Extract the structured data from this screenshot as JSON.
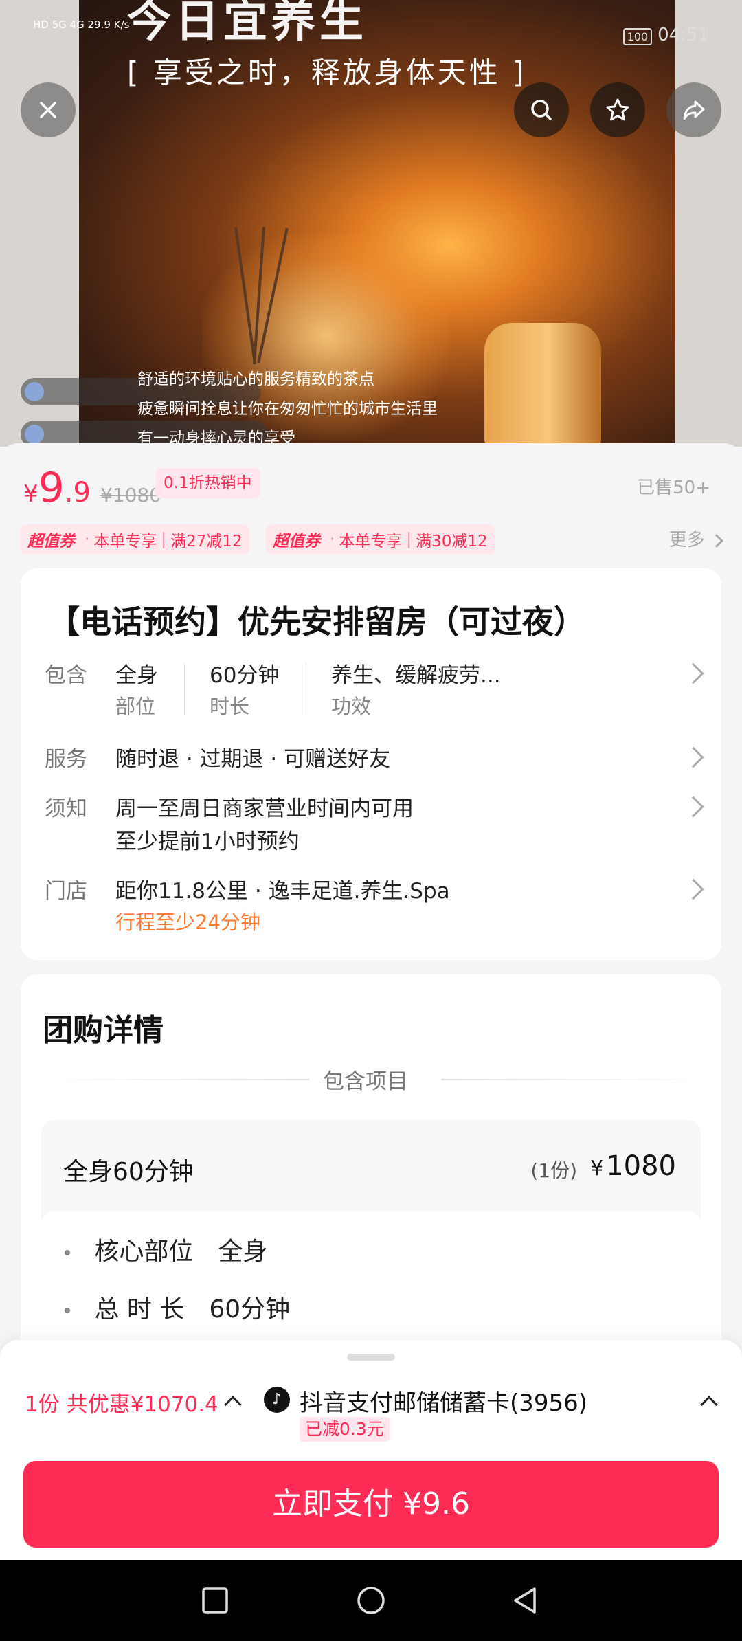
{
  "status_bar": {
    "left": "HD 5G 4G 29.9 K/s",
    "battery": "100",
    "time": "04:51"
  },
  "hero": {
    "title": "今日宜养生",
    "subtitle": "[ 享受之时，释放身体天性 ]",
    "caption_1": "舒适的环境贴心的服务精致的茶点",
    "caption_2": "疲惫瞬间拴息让你在匆匆忙忙的城市生活里",
    "caption_3": "有一动身摔心灵的享受",
    "icons": [
      "close-icon",
      "search-icon",
      "star-icon",
      "share-icon"
    ]
  },
  "price": {
    "symbol": "¥",
    "integer": "9",
    "decimal": ".9",
    "original": "¥1080",
    "tag": "0.1折热销中",
    "sold": "已售50+"
  },
  "coupons": [
    {
      "badge": "超值券",
      "scope": "本单专享",
      "rule": "满27减12"
    },
    {
      "badge": "超值券",
      "scope": "本单专享",
      "rule": "满30减12"
    }
  ],
  "coupons_more": "更多",
  "product": {
    "title": "【电话预约】优先安排留房（可过夜）",
    "include_label": "包含",
    "include": [
      {
        "value": "全身",
        "label": "部位"
      },
      {
        "value": "60分钟",
        "label": "时长"
      },
      {
        "value": "养生、缓解疲劳...",
        "label": "功效"
      }
    ],
    "service_label": "服务",
    "service": "随时退 · 过期退 · 可赠送好友",
    "notice_label": "须知",
    "notice_1": "周一至周日商家营业时间内可用",
    "notice_2": "至少提前1小时预约",
    "store_label": "门店",
    "store": "距你11.8公里 · 逸丰足道.养生.Spa",
    "store_travel": "行程至少24分钟"
  },
  "group_detail": {
    "title": "团购详情",
    "section": "包含项目",
    "item_name": "全身60分钟",
    "item_qty": "(1份)",
    "item_price_symbol": "¥",
    "item_price": "1080",
    "attrs": [
      {
        "key": "核心部位",
        "value": "全身"
      },
      {
        "key": "总 时 长",
        "value": "60分钟"
      }
    ]
  },
  "checkout": {
    "discount": "1份 共优惠¥1070.4",
    "pay_method": "抖音支付邮储储蓄卡(3956)",
    "reduced": "已减0.3元",
    "pay_button": "立即支付 ¥9.6"
  },
  "colors": {
    "accent": "#fe2c55",
    "orange": "#ff7a2e"
  }
}
